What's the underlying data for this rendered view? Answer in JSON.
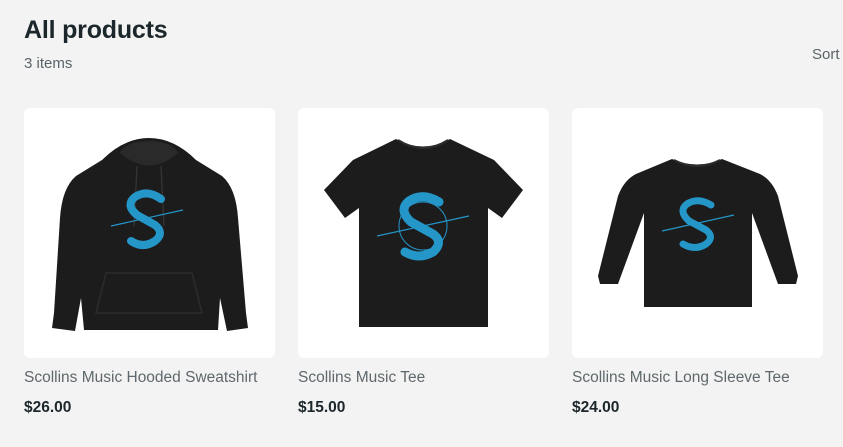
{
  "header": {
    "title": "All products",
    "count": "3 items",
    "sort_label": "Sort"
  },
  "colors": {
    "garment": "#1c1c1c",
    "logo": "#2596c8"
  },
  "products": [
    {
      "title": "Scollins Music Hooded Sweatshirt",
      "price": "$26.00",
      "image": "hoodie-image"
    },
    {
      "title": "Scollins Music Tee",
      "price": "$15.00",
      "image": "tshirt-image"
    },
    {
      "title": "Scollins Music Long Sleeve Tee",
      "price": "$24.00",
      "image": "long-sleeve-image"
    }
  ]
}
